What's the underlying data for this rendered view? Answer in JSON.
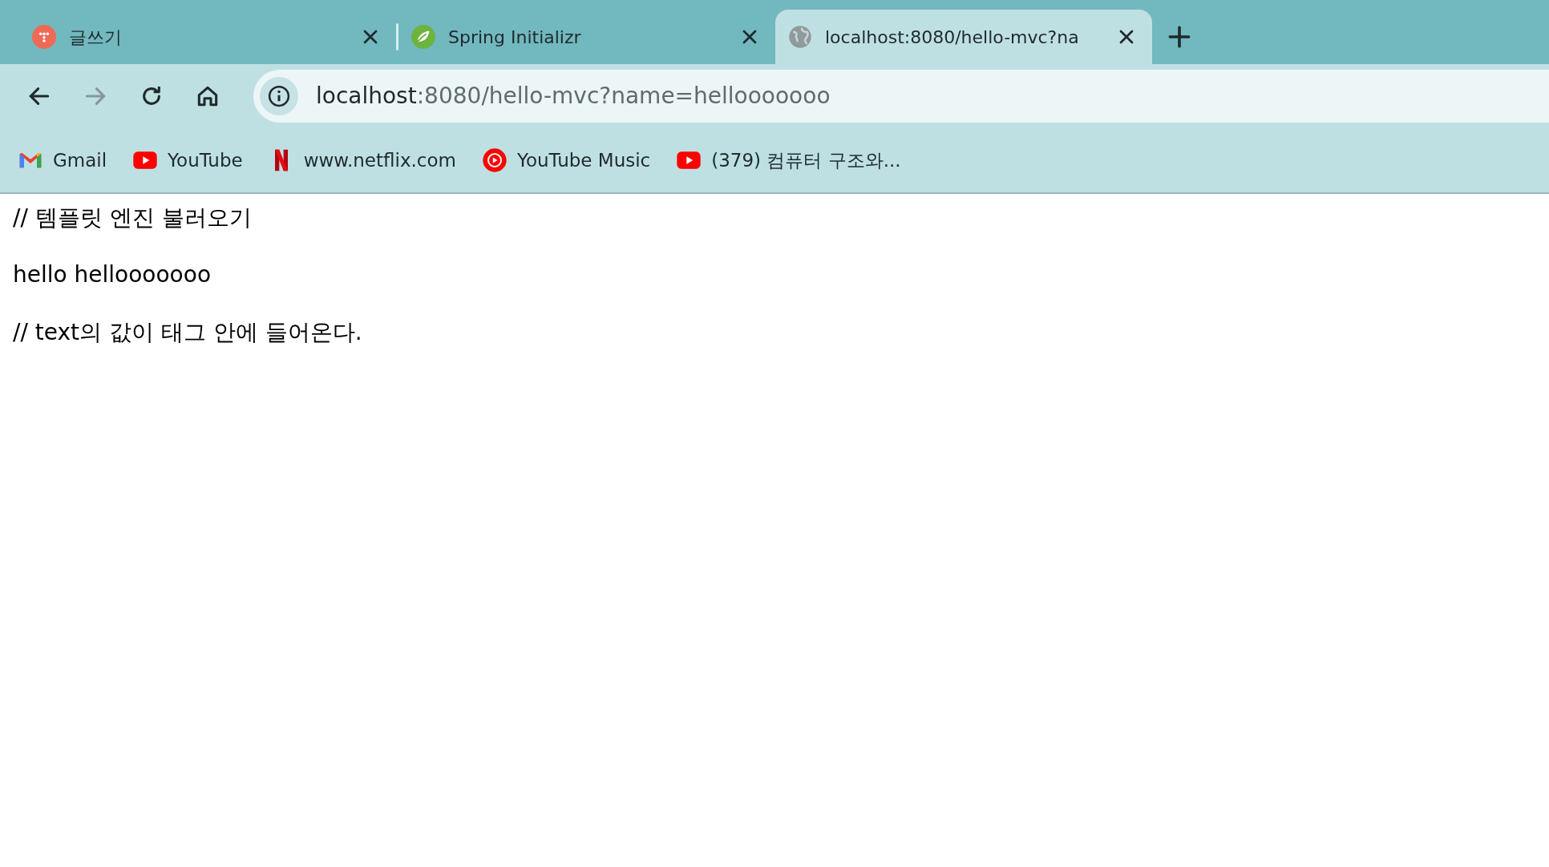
{
  "tabs": [
    {
      "title": "글쓰기",
      "kind": "dots",
      "selected": false
    },
    {
      "title": "Spring Initializr",
      "kind": "leaf",
      "selected": false
    },
    {
      "title": "localhost:8080/hello-mvc?na",
      "kind": "globe",
      "selected": true
    }
  ],
  "toolbar": {
    "back_disabled": false,
    "forward_disabled": true
  },
  "address": {
    "host": "localhost",
    "rest": ":8080/hello-mvc?name=hellooooooo"
  },
  "bookmarks": [
    {
      "label": "Gmail",
      "kind": "gmail"
    },
    {
      "label": "YouTube",
      "kind": "youtube"
    },
    {
      "label": "www.netflix.com",
      "kind": "netflix"
    },
    {
      "label": "YouTube Music",
      "kind": "ytmusic"
    },
    {
      "label": "(379) 컴퓨터 구조와...",
      "kind": "youtube"
    }
  ],
  "content": [
    "// 템플릿 엔진 불러오기",
    "hello hellooooooo",
    "// text의 값이 태그 안에 들어온다."
  ]
}
